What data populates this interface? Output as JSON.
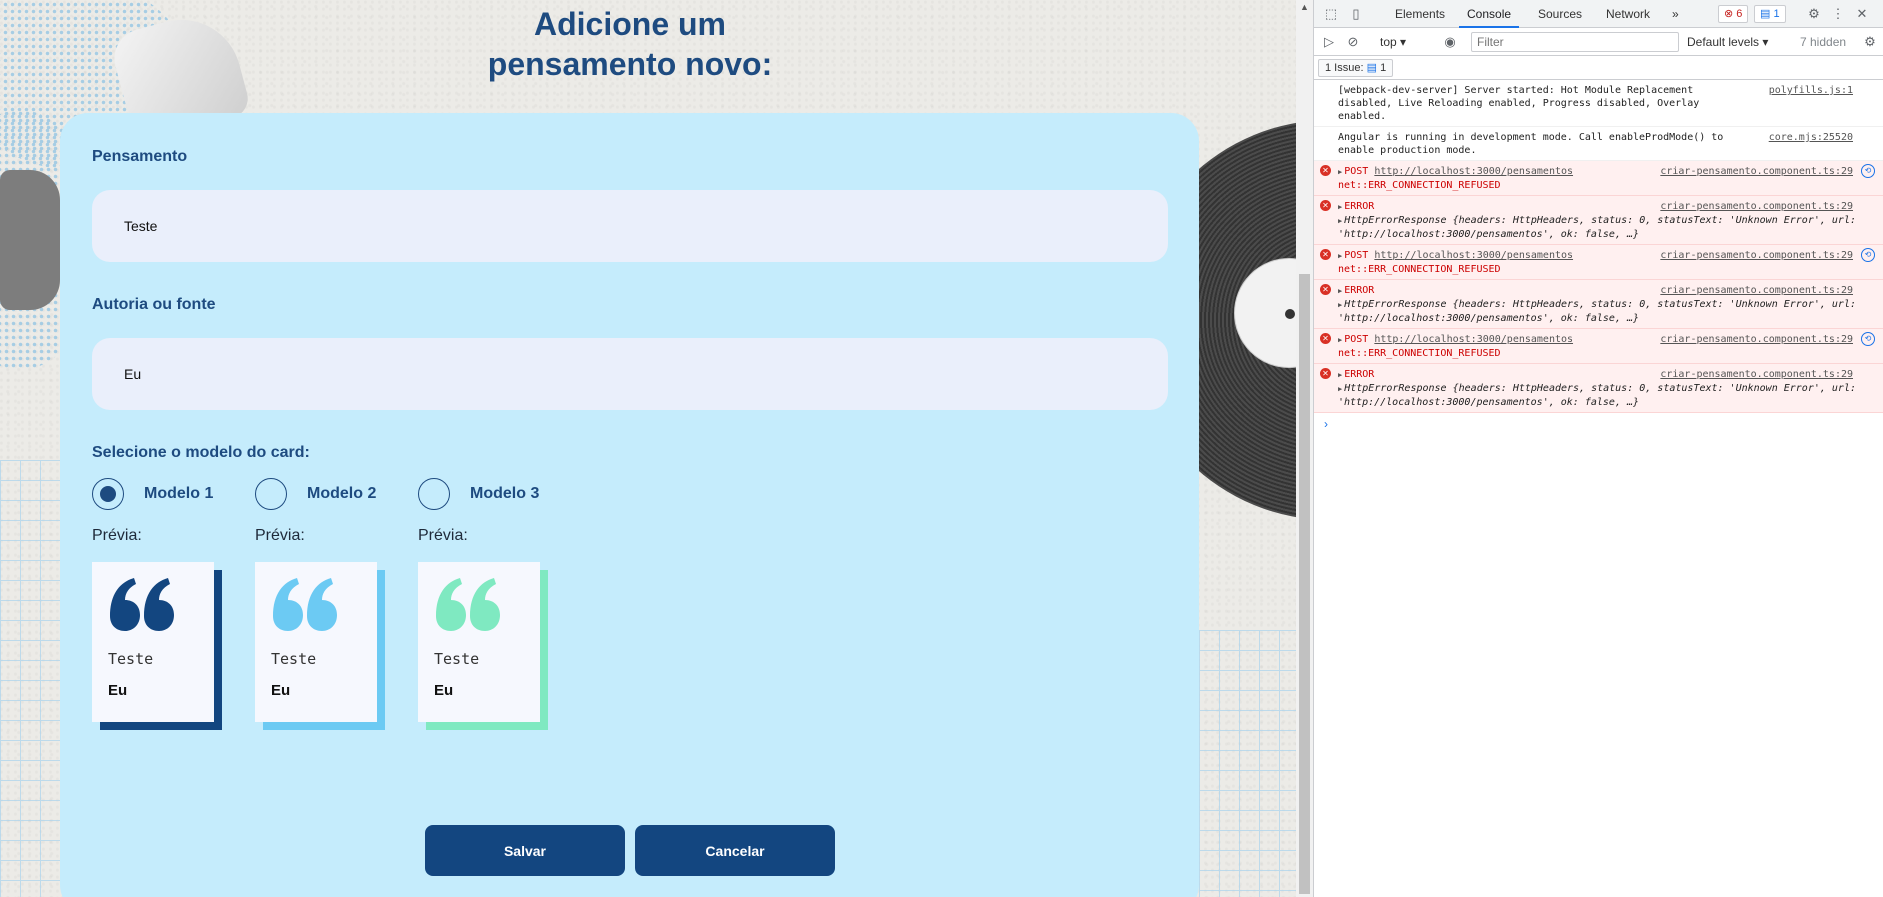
{
  "page": {
    "title": "Adicione um\npensamento novo:",
    "title_line1": "Adicione um",
    "title_line2": "pensamento novo:",
    "colors": {
      "primary": "#134680",
      "card_bg": "#c5ecfc",
      "input_bg": "#eaeffb"
    }
  },
  "form": {
    "pensamento_label": "Pensamento",
    "pensamento_value": "Teste",
    "autoria_label": "Autoria ou fonte",
    "autoria_value": "Eu",
    "modelo_label": "Selecione o modelo do card:",
    "modelos": [
      {
        "label": "Modelo 1",
        "selected": true,
        "color": "#134680"
      },
      {
        "label": "Modelo 2",
        "selected": false,
        "color": "#6ccaf3"
      },
      {
        "label": "Modelo 3",
        "selected": false,
        "color": "#7fe9c1"
      }
    ],
    "preview_label": "Prévia:",
    "preview_text": "Teste",
    "preview_author": "Eu",
    "save_label": "Salvar",
    "cancel_label": "Cancelar"
  },
  "devtools": {
    "tabs": [
      "Elements",
      "Console",
      "Sources",
      "Network"
    ],
    "active_tab": "Console",
    "more_tabs": "»",
    "error_count": "6",
    "message_count": "1",
    "context": "top",
    "filter_placeholder": "Filter",
    "levels": "Default levels",
    "hidden": "7 hidden",
    "issues": "1 Issue:",
    "issues_count": "1",
    "logs": {
      "info1": {
        "msg": "[webpack-dev-server] Server started: Hot Module Replacement disabled, Live Reloading enabled, Progress disabled, Overlay enabled.",
        "src": "polyfills.js:1"
      },
      "info2": {
        "msg": "Angular is running in development mode. Call enableProdMode() to enable production mode.",
        "src": "core.mjs:25520"
      },
      "post_prefix": "POST",
      "post_url": "http://localhost:3000/pensamentos",
      "post_err": "net::ERR_CONNECTION_REFUSED",
      "post_src": "criar-pensamento.component.ts:29",
      "error_label": "ERROR",
      "error_src": "criar-pensamento.component.ts:29",
      "error_obj_name": "HttpErrorResponse",
      "error_obj_body": "{headers: HttpHeaders, status: 0, statusText: 'Unknown Error', url: 'http://localhost:3000/pensamentos', ok: false, …}"
    },
    "prompt": "›"
  }
}
